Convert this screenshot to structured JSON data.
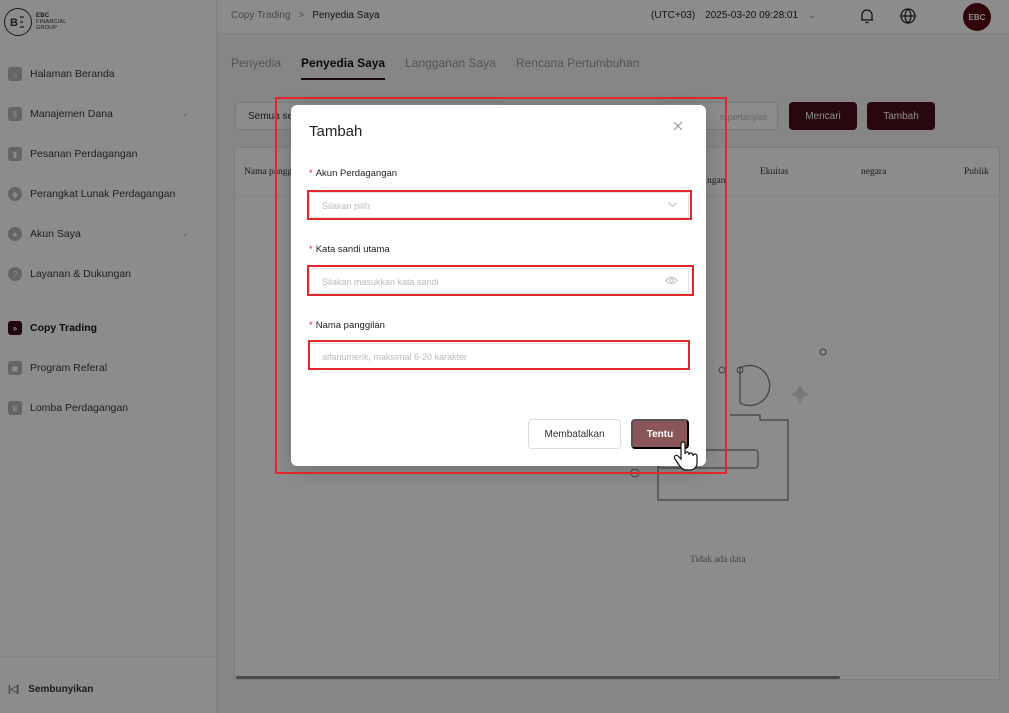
{
  "logo": {
    "mark": "EBC",
    "line1": "EBC",
    "line2": "FINANCIAL",
    "line3": "GROUP"
  },
  "sidebar": {
    "items": [
      {
        "label": "Halaman Beranda"
      },
      {
        "label": "Manajemen Dana"
      },
      {
        "label": "Pesanan Perdagangan"
      },
      {
        "label": "Perangkat Lunak Perdagangan"
      },
      {
        "label": "Akun Saya"
      },
      {
        "label": "Layanan & Dukungan"
      },
      {
        "label": "Copy Trading"
      },
      {
        "label": "Program Referal"
      },
      {
        "label": "Lomba Perdagangan"
      }
    ],
    "collapse_label": "Sembunyikan"
  },
  "header": {
    "breadcrumb_root": "Copy Trading",
    "breadcrumb_sep": ">",
    "breadcrumb_current": "Penyedia Saya",
    "timezone": "(UTC+03)",
    "datetime": "2025-03-20 09:28:01"
  },
  "tabs": [
    {
      "label": "Penyedia"
    },
    {
      "label": "Penyedia Saya"
    },
    {
      "label": "Langganan Saya"
    },
    {
      "label": "Rencana Pertumbuhan"
    }
  ],
  "filters": {
    "status_value": "Semua se",
    "search_placeholder": "n pertanyas",
    "search_label": "Mencari",
    "add_label": "Tambah"
  },
  "table": {
    "columns": [
      "Nama pangg",
      "ngan",
      "Ekuitas",
      "negara",
      "Publik"
    ],
    "empty_text": "Tidak ada data"
  },
  "modal": {
    "title": "Tambah",
    "fields": {
      "account_label": "Akun Perdagangan",
      "account_placeholder": "Silakan pilih",
      "password_label": "Kata sandi utama",
      "password_placeholder": "Silakan masukkan kata sandi",
      "nickname_label": "Nama panggilan",
      "nickname_placeholder": "alfanumerik, maksimal 6-20 karakter"
    },
    "required_mark": "*",
    "cancel_label": "Membatalkan",
    "confirm_label": "Tentu"
  },
  "colors": {
    "brand": "#4a0f1b",
    "confirm": "#8b5659",
    "highlight": "#e3262c"
  }
}
